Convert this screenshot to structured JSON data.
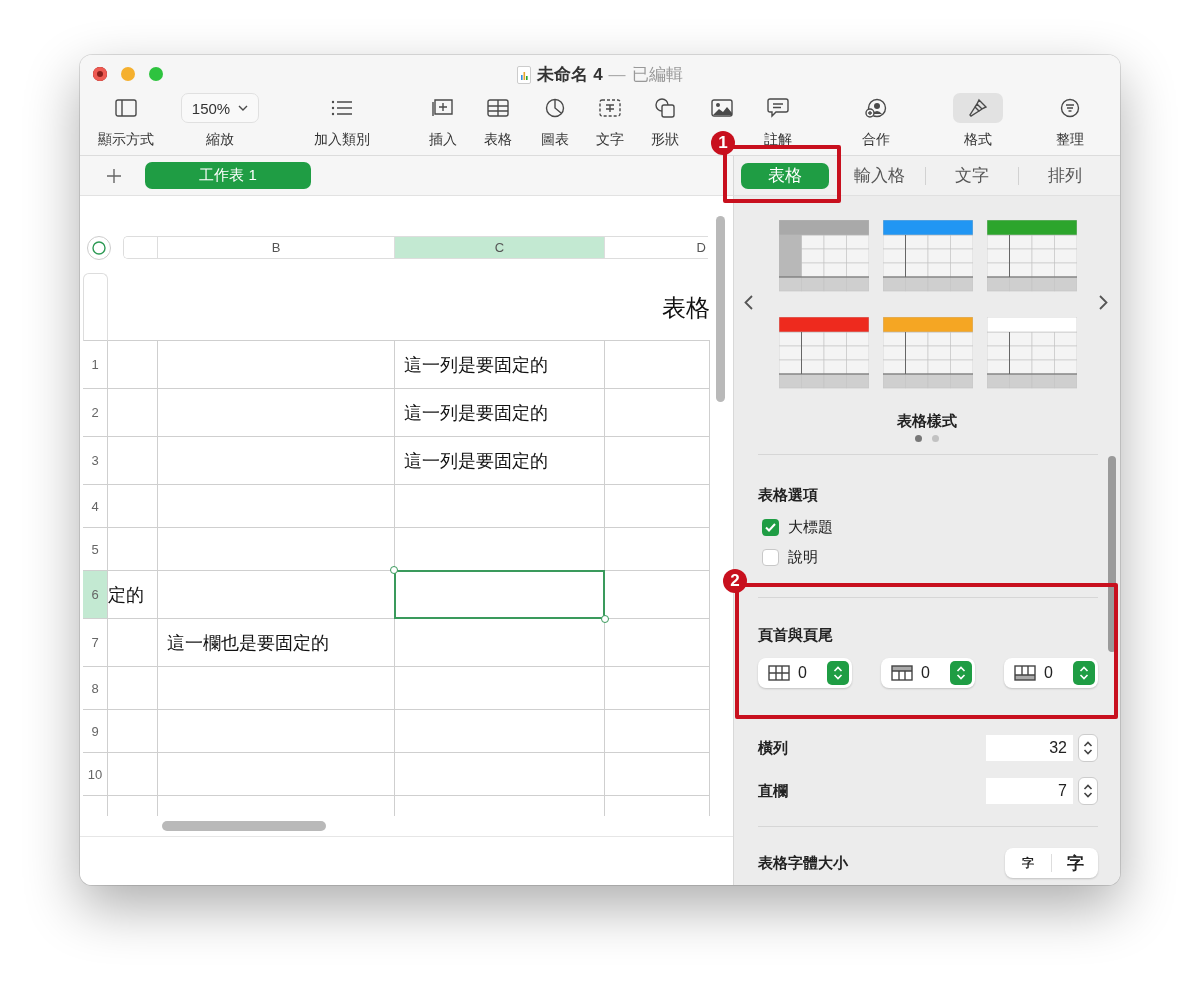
{
  "window": {
    "title": "未命名 4",
    "separator": "—",
    "status": "已編輯"
  },
  "toolbar": [
    {
      "label": "顯示方式",
      "kind": "button",
      "selected": false
    },
    {
      "label": "縮放",
      "kind": "zoom",
      "value": "150%",
      "selected": false
    },
    {
      "label": "加入類別",
      "kind": "button",
      "selected": false
    },
    {
      "label": "插入",
      "kind": "button",
      "selected": false
    },
    {
      "label": "表格",
      "kind": "button",
      "selected": false
    },
    {
      "label": "圖表",
      "kind": "button",
      "selected": false
    },
    {
      "label": "文字",
      "kind": "button",
      "selected": false
    },
    {
      "label": "形狀",
      "kind": "button",
      "selected": false
    },
    {
      "kind": "button",
      "selected": false
    },
    {
      "label": "註解",
      "kind": "button",
      "selected": false
    },
    {
      "label": "合作",
      "kind": "button",
      "selected": false
    },
    {
      "label": "格式",
      "kind": "button",
      "selected": true
    },
    {
      "label": "整理",
      "kind": "button",
      "selected": false
    }
  ],
  "sheet_tabs": [
    {
      "label": "工作表 1",
      "selected": true
    }
  ],
  "table": {
    "title": "表格",
    "columns": [
      {
        "selected": false
      },
      {
        "label": "B",
        "selected": false
      },
      {
        "label": "C",
        "selected": true
      },
      {
        "label": "D",
        "selected": false
      }
    ],
    "rows": [
      {
        "number": "1",
        "selected": false,
        "c": "這一列是要固定的"
      },
      {
        "number": "2",
        "selected": false,
        "c": "這一列是要固定的"
      },
      {
        "number": "3",
        "selected": false,
        "c": "這一列是要固定的"
      },
      {
        "number": "4",
        "selected": false
      },
      {
        "number": "5",
        "selected": false
      },
      {
        "number": "6",
        "selected": true,
        "a": "定的"
      },
      {
        "number": "7",
        "selected": false,
        "b": "這一欄也是要固定的"
      },
      {
        "number": "8",
        "selected": false
      },
      {
        "number": "9",
        "selected": false
      },
      {
        "number": "10",
        "selected": false
      },
      {
        "selected": false
      }
    ]
  },
  "inspector": {
    "tabs": [
      {
        "label": "表格",
        "selected": true
      },
      {
        "label": "輸入格",
        "selected": false
      },
      {
        "label": "文字",
        "selected": false
      },
      {
        "label": "排列",
        "selected": false
      }
    ],
    "table_styles": {
      "styles": [
        {
          "color": "#a9a9a9",
          "header_column": true
        },
        {
          "color": "#2196f3",
          "header_column": false
        },
        {
          "color": "#2ca52c",
          "header_column": false
        },
        {
          "color": "#ee2a1e",
          "header_column": false
        },
        {
          "color": "#f5a623",
          "header_column": false
        },
        {
          "color": "#ffffff",
          "header_column": false
        }
      ],
      "label": "表格樣式",
      "pages": [
        {
          "selected": true
        },
        {
          "selected": false
        }
      ]
    },
    "table_options": {
      "title": "表格選項",
      "options": [
        {
          "label": "大標題",
          "checked": true
        },
        {
          "label": "說明",
          "checked": false
        }
      ]
    },
    "headers_footers": {
      "title": "頁首與頁尾",
      "steppers": [
        {
          "value": "0"
        },
        {
          "value": "0"
        },
        {
          "value": "0"
        }
      ]
    },
    "size": [
      {
        "label": "橫列",
        "value": "32"
      },
      {
        "label": "直欄",
        "value": "7"
      }
    ],
    "font_size": {
      "label": "表格字體大小",
      "buttons": [
        "字",
        "字"
      ]
    }
  },
  "annotations": [
    {
      "number": "1"
    },
    {
      "number": "2"
    }
  ]
}
